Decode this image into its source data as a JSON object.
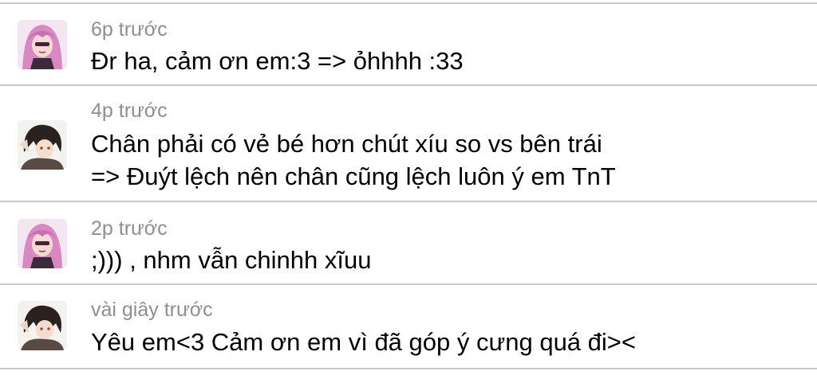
{
  "comments": [
    {
      "avatar": "pink-hair-avatar-icon",
      "time": "6p trước",
      "lines": [
        "Đr ha, cảm ơn em:3 => ỏhhhh :33"
      ]
    },
    {
      "avatar": "dark-hair-avatar-icon",
      "time": "4p trước",
      "lines": [
        "Chân phải có vẻ bé hơn chút xíu so vs bên trái",
        "=> Đuýt lệch nên chân cũng lệch luôn ý em TnT"
      ]
    },
    {
      "avatar": "pink-hair-avatar-icon",
      "time": "2p trước",
      "lines": [
        ";))) , nhm vẫn chinhh xĩuu"
      ]
    },
    {
      "avatar": "dark-hair-avatar-icon",
      "time": "vài giây trước",
      "lines": [
        "Yêu em<3 Cảm ơn em vì đã góp ý cưng quá đi><"
      ]
    }
  ],
  "colors": {
    "separator": "#c9c9c9",
    "timestamp": "#8e8e93",
    "text": "#000000",
    "background": "#ffffff"
  }
}
